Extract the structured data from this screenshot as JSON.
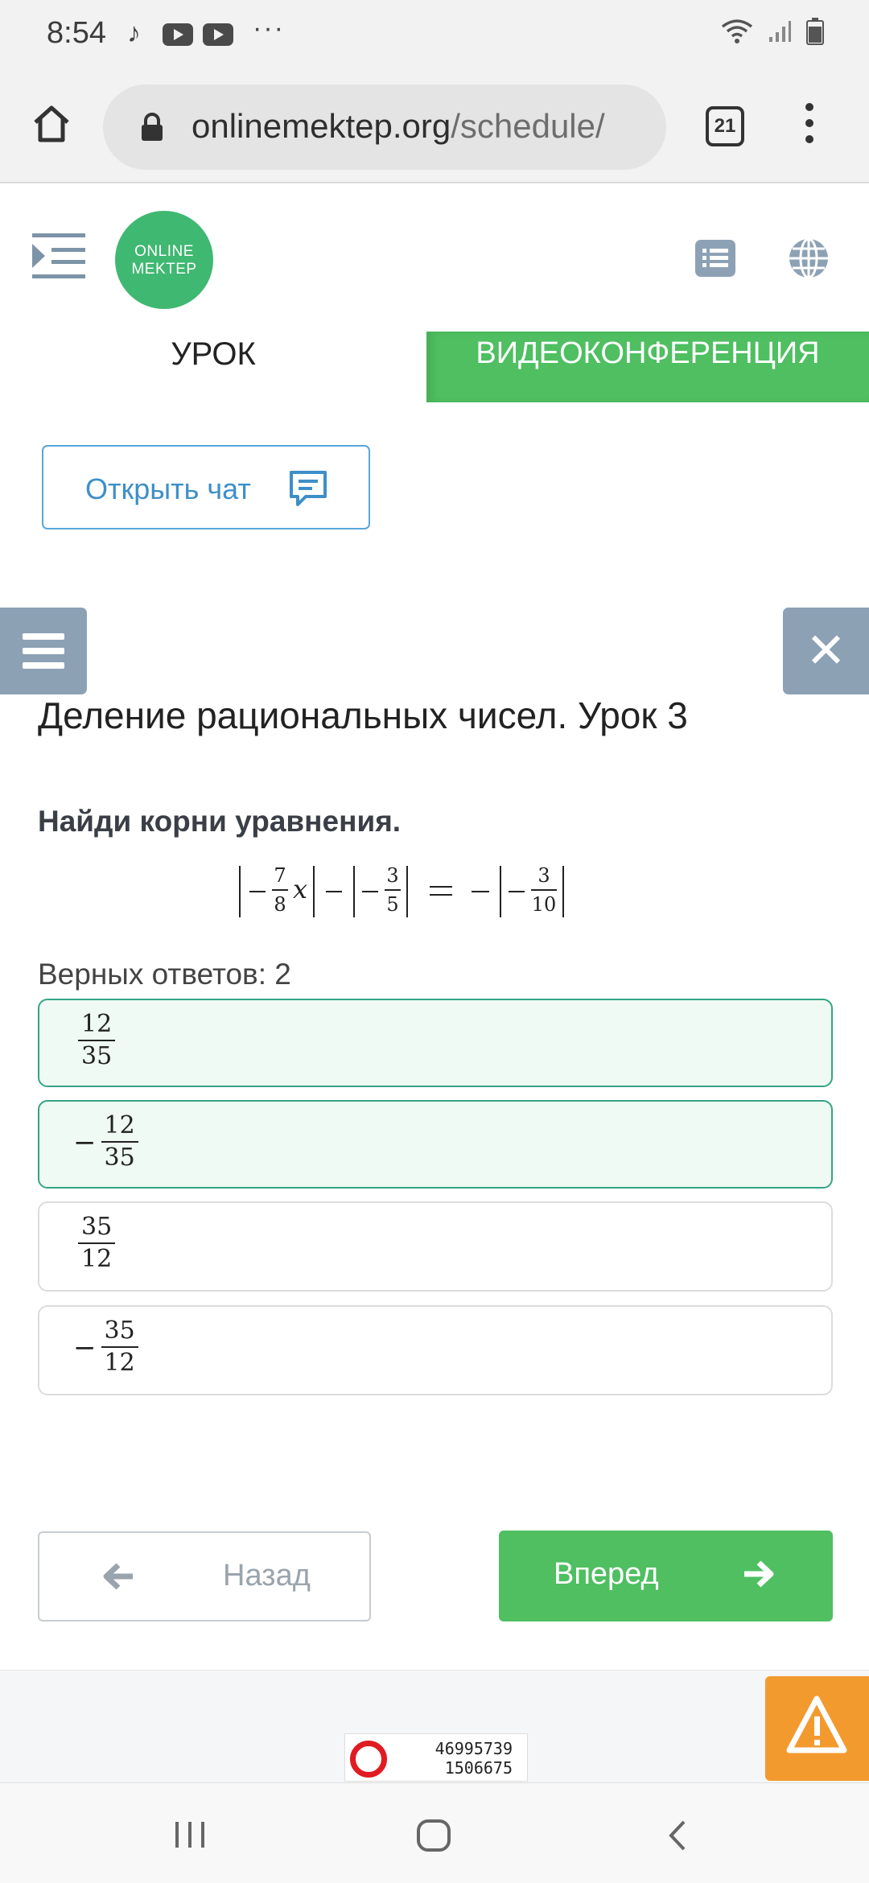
{
  "status_bar": {
    "time": "8:54",
    "dots": "···"
  },
  "browser": {
    "url_main": "onlinemektep.org",
    "url_path": "/schedule/",
    "tab_count": "21"
  },
  "header": {
    "logo_line1": "ONLINE",
    "logo_line2": "MEKTEP"
  },
  "tabs": {
    "lesson": "УРОК",
    "video": "ВИДЕОКОНФЕРЕНЦИЯ"
  },
  "chat_button": {
    "label": "Открыть чат"
  },
  "lesson": {
    "title": "Деление рациональных чисел. Урок 3",
    "question": "Найди корни уравнения.",
    "correct_count": "Верных ответов: 2"
  },
  "equation": {
    "term1_num": "7",
    "term1_den": "8",
    "var": "x",
    "term2_num": "3",
    "term2_den": "5",
    "term3_num": "3",
    "term3_den": "10"
  },
  "answers": [
    {
      "sign": "",
      "num": "12",
      "den": "35",
      "selected": true
    },
    {
      "sign": "−",
      "num": "12",
      "den": "35",
      "selected": true
    },
    {
      "sign": "",
      "num": "35",
      "den": "12",
      "selected": false
    },
    {
      "sign": "−",
      "num": "35",
      "den": "12",
      "selected": false
    }
  ],
  "navigation": {
    "back": "Назад",
    "forward": "Вперед"
  },
  "counter": {
    "line1": "46995739",
    "line2": "1506675"
  },
  "colors": {
    "green": "#4fbf61",
    "blue_gray": "#8da1b5",
    "orange": "#f39a2f",
    "chat_blue": "#3e8fc8"
  }
}
